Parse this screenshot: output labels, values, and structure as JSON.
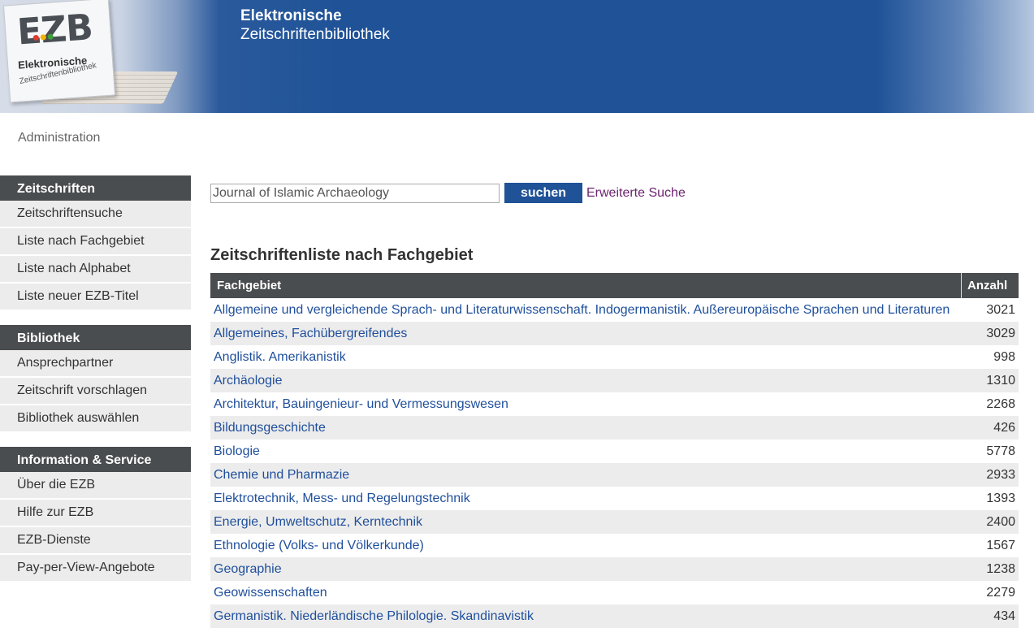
{
  "header": {
    "logo_text": "EZB",
    "logo_sub1": "Elektronische",
    "logo_sub2": "Zeitschriftenbibliothek",
    "title_line1": "Elektronische",
    "title_line2": "Zeitschriftenbibliothek"
  },
  "admin_label": "Administration",
  "sidebar": {
    "groups": [
      {
        "heading": "Zeitschriften",
        "items": [
          "Zeitschriftensuche",
          "Liste nach Fachgebiet",
          "Liste nach Alphabet",
          "Liste neuer EZB-Titel"
        ]
      },
      {
        "heading": "Bibliothek",
        "items": [
          "Ansprechpartner",
          "Zeitschrift vorschlagen",
          "Bibliothek auswählen"
        ]
      },
      {
        "heading": "Information & Service",
        "items": [
          "Über die EZB",
          "Hilfe zur EZB",
          "EZB-Dienste",
          "Pay-per-View-Angebote"
        ]
      }
    ]
  },
  "search": {
    "value": "Journal of Islamic Archaeology",
    "button_label": "suchen",
    "advanced_label": "Erweiterte Suche"
  },
  "list": {
    "title": "Zeitschriftenliste nach Fachgebiet",
    "columns": [
      "Fachgebiet",
      "Anzahl"
    ],
    "rows": [
      {
        "name": "Allgemeine und vergleichende Sprach- und Literaturwissenschaft. Indogermanistik. Außereuropäische Sprachen und Literaturen",
        "count": "3021"
      },
      {
        "name": "Allgemeines, Fachübergreifendes",
        "count": "3029"
      },
      {
        "name": "Anglistik. Amerikanistik",
        "count": "998"
      },
      {
        "name": "Archäologie",
        "count": "1310"
      },
      {
        "name": "Architektur, Bauingenieur- und Vermessungswesen",
        "count": "2268"
      },
      {
        "name": "Bildungsgeschichte",
        "count": "426"
      },
      {
        "name": "Biologie",
        "count": "5778"
      },
      {
        "name": "Chemie und Pharmazie",
        "count": "2933"
      },
      {
        "name": "Elektrotechnik, Mess- und Regelungstechnik",
        "count": "1393"
      },
      {
        "name": "Energie, Umweltschutz, Kerntechnik",
        "count": "2400"
      },
      {
        "name": "Ethnologie (Volks- und Völkerkunde)",
        "count": "1567"
      },
      {
        "name": "Geographie",
        "count": "1238"
      },
      {
        "name": "Geowissenschaften",
        "count": "2279"
      },
      {
        "name": "Germanistik. Niederländische Philologie. Skandinavistik",
        "count": "434"
      }
    ]
  },
  "colors": {
    "header_blue": "#1f5297",
    "sidebar_heading": "#4a4d4f",
    "link_blue": "#1f4f9c",
    "visited_purple": "#6c2470"
  }
}
